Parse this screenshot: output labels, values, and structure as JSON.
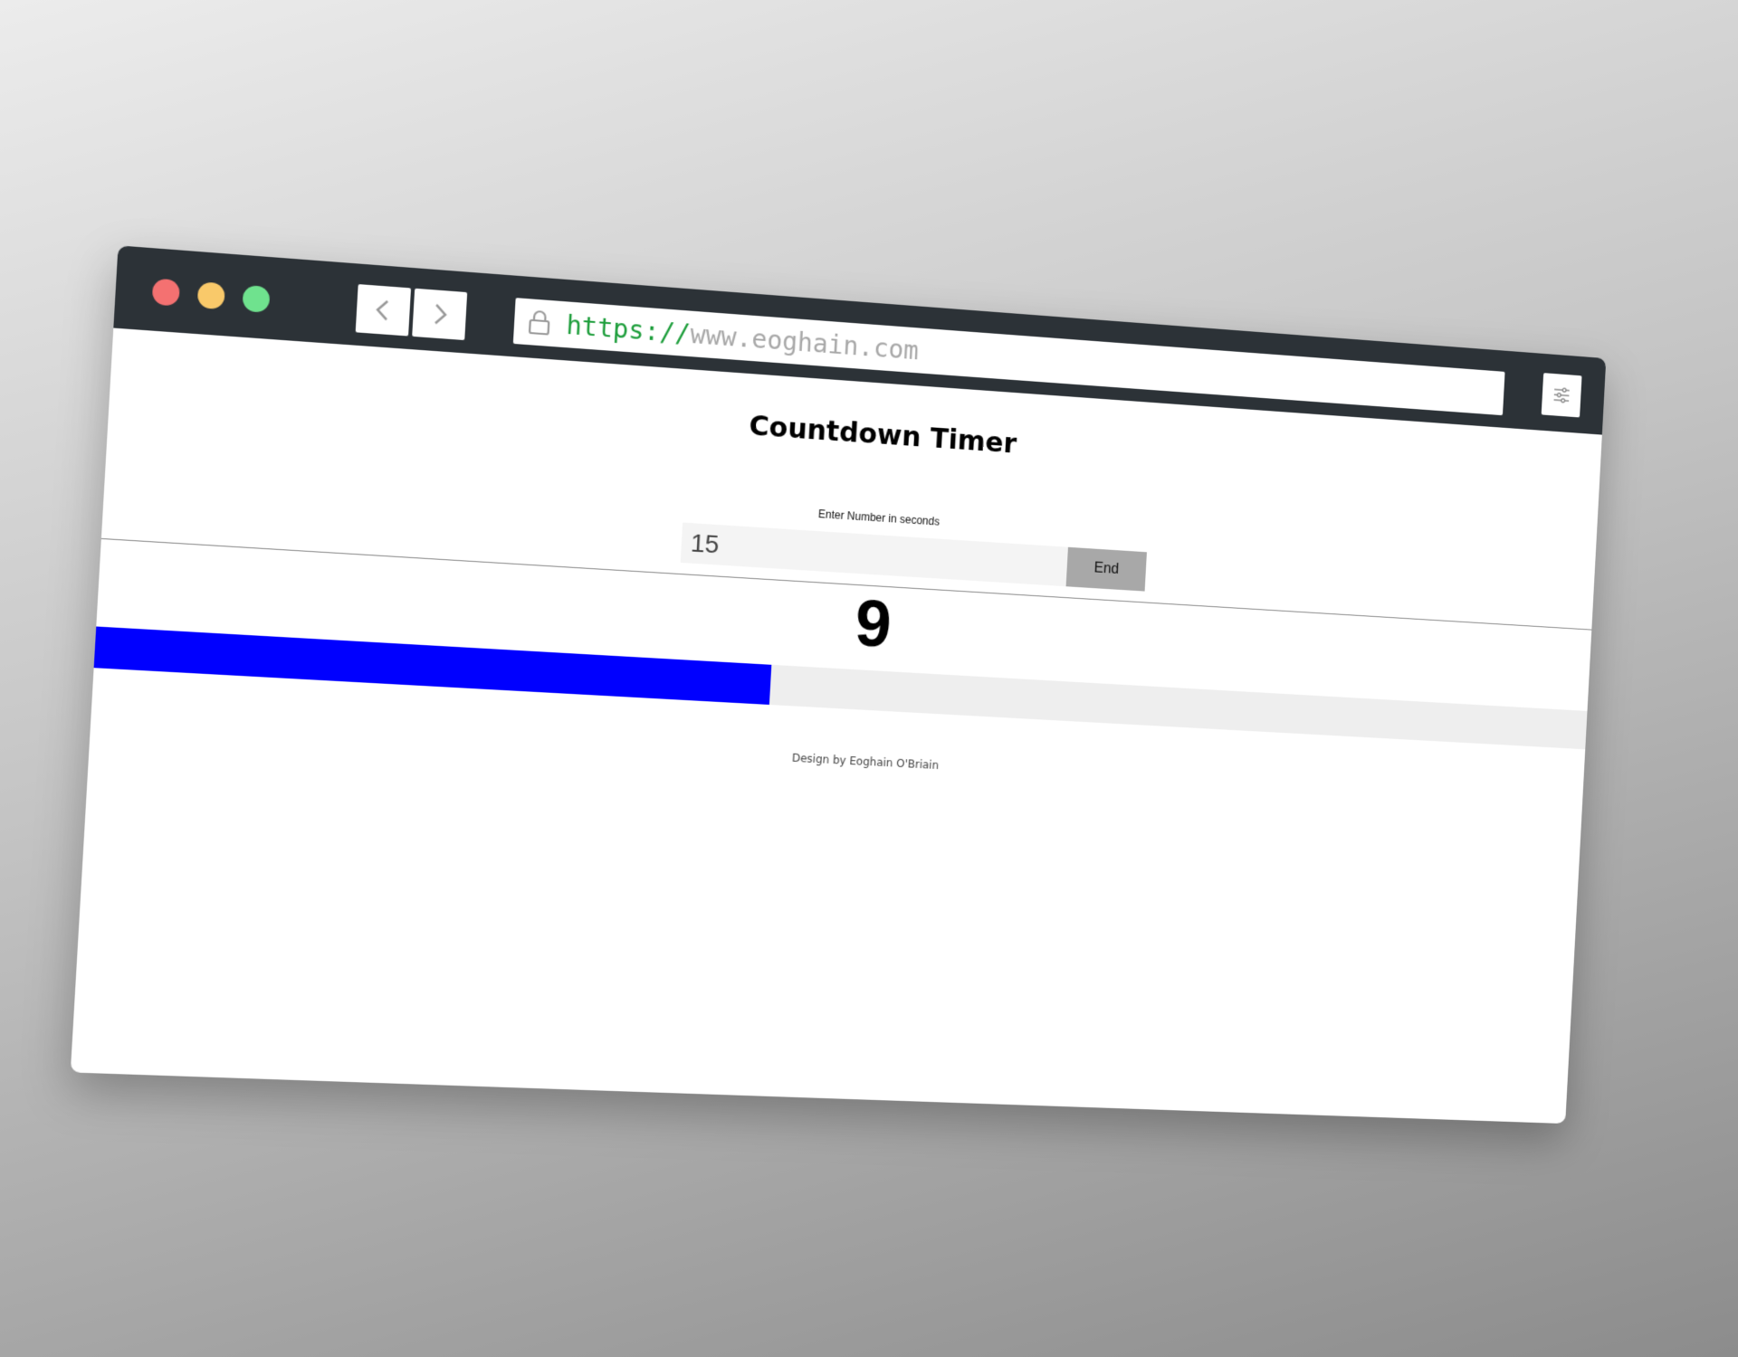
{
  "browser": {
    "url_scheme": "https://",
    "url_host": "www.eoghain.com",
    "back_label": "‹",
    "forward_label": "›"
  },
  "page": {
    "title": "Countdown Timer",
    "input_label": "Enter Number in seconds",
    "input_value": "15",
    "end_button_label": "End",
    "timer_value": "9",
    "progress_fraction": 0.434,
    "footer": "Design by Eoghain O'Briain"
  },
  "colors": {
    "toolbar": "#2c3237",
    "progress_fill": "#0000ff",
    "progress_track": "#eeeeee",
    "url_scheme": "#1e9e3c"
  },
  "icons": {
    "lock": "lock-icon",
    "menu": "sliders-icon",
    "back": "chevron-left-icon",
    "forward": "chevron-right-icon"
  }
}
